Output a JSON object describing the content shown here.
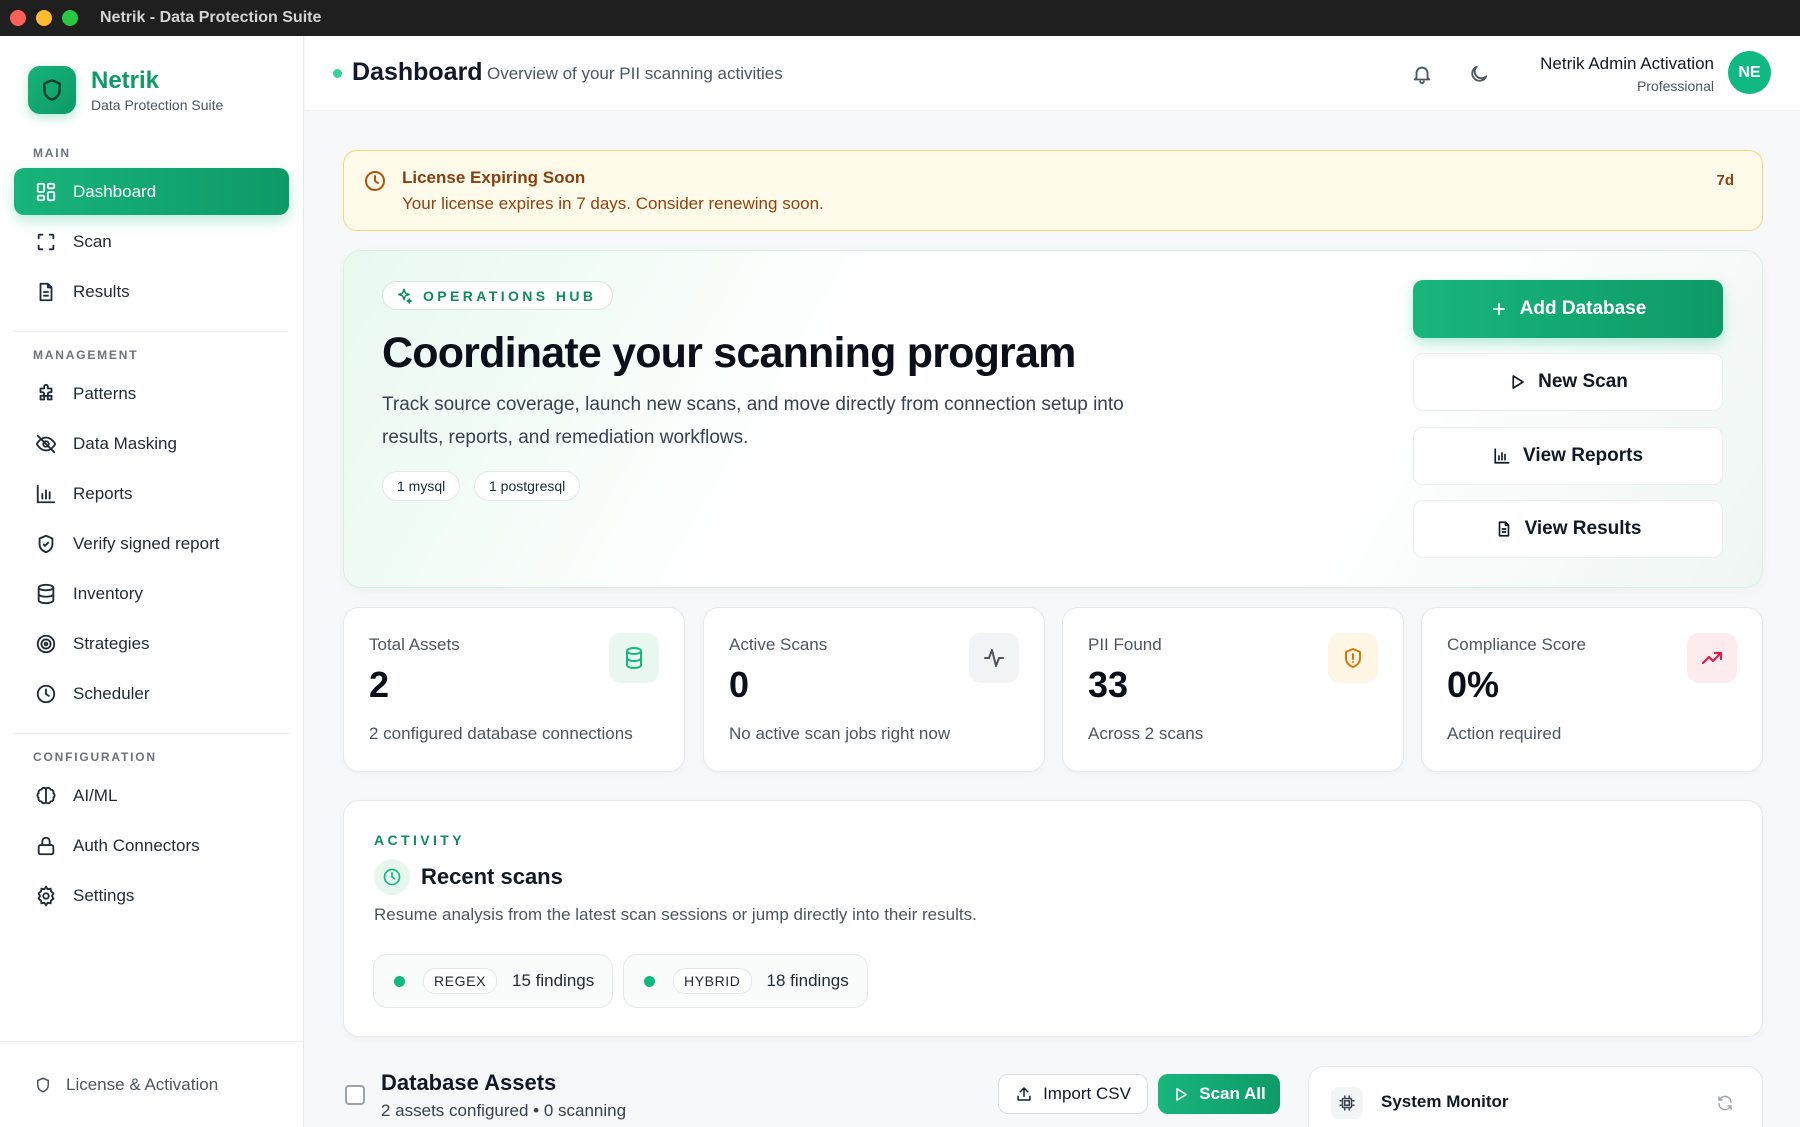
{
  "window": {
    "title": "Netrik - Data Protection Suite"
  },
  "brand": {
    "name": "Netrik",
    "subtitle": "Data Protection Suite"
  },
  "sidebar": {
    "sections": [
      {
        "label": "MAIN"
      },
      {
        "label": "MANAGEMENT"
      },
      {
        "label": "CONFIGURATION"
      }
    ],
    "items": [
      {
        "label": "Dashboard",
        "icon": "dashboard-grid-icon",
        "active": true
      },
      {
        "label": "Scan",
        "icon": "scan-frame-icon"
      },
      {
        "label": "Results",
        "icon": "document-icon"
      },
      {
        "label": "Patterns",
        "icon": "puzzle-icon"
      },
      {
        "label": "Data Masking",
        "icon": "eye-off-icon"
      },
      {
        "label": "Reports",
        "icon": "bar-chart-icon"
      },
      {
        "label": "Verify signed report",
        "icon": "shield-check-icon"
      },
      {
        "label": "Inventory",
        "icon": "database-icon"
      },
      {
        "label": "Strategies",
        "icon": "target-icon"
      },
      {
        "label": "Scheduler",
        "icon": "clock-icon"
      },
      {
        "label": "AI/ML",
        "icon": "brain-icon"
      },
      {
        "label": "Auth Connectors",
        "icon": "lock-icon"
      },
      {
        "label": "Settings",
        "icon": "gear-icon"
      }
    ],
    "footer": {
      "label": "License & Activation",
      "icon": "shield-icon"
    }
  },
  "header": {
    "title": "Dashboard",
    "subtitle": "Overview of your PII scanning activities",
    "user": {
      "name": "Netrik Admin Activation",
      "role": "Professional",
      "initials": "NE"
    }
  },
  "license": {
    "title": "License Expiring Soon",
    "message": "Your license expires in 7 days. Consider renewing soon.",
    "days": "7d"
  },
  "hero": {
    "kicker": "OPERATIONS HUB",
    "title": "Coordinate your scanning program",
    "description": "Track source coverage, launch new scans, and move directly from connection setup into results, reports, and remediation workflows.",
    "chips": [
      "1 mysql",
      "1 postgresql"
    ],
    "actions": [
      {
        "label": "Add Database",
        "icon": "plus-icon"
      },
      {
        "label": "New Scan",
        "icon": "play-icon"
      },
      {
        "label": "View Reports",
        "icon": "bar-chart-icon"
      },
      {
        "label": "View Results",
        "icon": "document-icon"
      }
    ]
  },
  "stats": [
    {
      "label": "Total Assets",
      "value": "2",
      "sub": "2 configured database connections",
      "icon": "database-icon",
      "color": "#10b981",
      "bg": "#e8f8f0"
    },
    {
      "label": "Active Scans",
      "value": "0",
      "sub": "No active scan jobs right now",
      "icon": "activity-icon",
      "color": "#4b5563",
      "bg": "#f1f3f5"
    },
    {
      "label": "PII Found",
      "value": "33",
      "sub": "Across 2 scans",
      "icon": "shield-alert-icon",
      "color": "#d97706",
      "bg": "#fff7e6"
    },
    {
      "label": "Compliance Score",
      "value": "0%",
      "sub": "Action required",
      "icon": "trending-up-icon",
      "color": "#e11d48",
      "bg": "#fdecef"
    }
  ],
  "activity": {
    "kicker": "ACTIVITY",
    "title": "Recent scans",
    "description": "Resume analysis from the latest scan sessions or jump directly into their results.",
    "scans": [
      {
        "type": "REGEX",
        "findings": "15 findings"
      },
      {
        "type": "HYBRID",
        "findings": "18 findings"
      }
    ]
  },
  "database_assets": {
    "title": "Database Assets",
    "subtitle": "2 assets configured • 0 scanning",
    "import_label": "Import CSV",
    "scan_all_label": "Scan All"
  },
  "system_monitor": {
    "title": "System Monitor"
  },
  "colors": {
    "accent": "#10b981",
    "accent_dark": "#0e9a66",
    "warning_bg": "#fffbea",
    "warning_text": "#92400e"
  }
}
